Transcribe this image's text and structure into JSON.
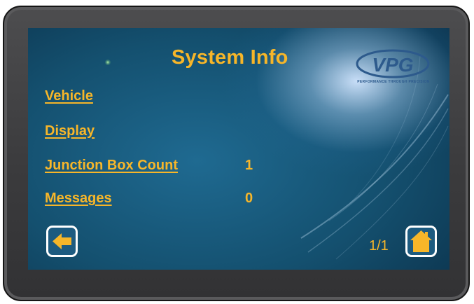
{
  "screen": {
    "title": "System Info",
    "logo": {
      "text": "VPG",
      "tagline": "PERFORMANCE THROUGH PRECISION"
    },
    "rows": [
      {
        "label": "Vehicle",
        "value": ""
      },
      {
        "label": "Display",
        "value": ""
      },
      {
        "label": "Junction Box Count",
        "value": "1"
      },
      {
        "label": "Messages",
        "value": "0"
      }
    ],
    "page_indicator": "1/1",
    "buttons": {
      "back_icon": "arrow-left-icon",
      "home_icon": "home-icon"
    }
  },
  "colors": {
    "accent": "#f7b629",
    "screen_background": "#14506f",
    "bezel": "#3b3b3d",
    "logo_blue": "#2d5a8c"
  }
}
